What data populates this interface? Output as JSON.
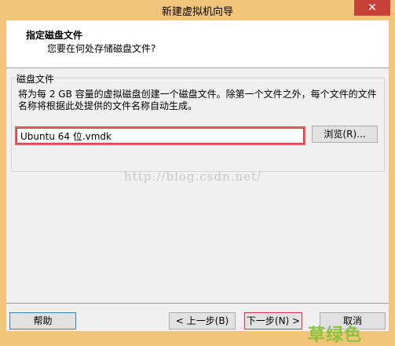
{
  "window": {
    "title": "新建虚拟机向导",
    "close_label": "✕"
  },
  "header": {
    "title": "指定磁盘文件",
    "subtitle": "您要在何处存储磁盘文件?"
  },
  "group": {
    "label": "磁盘文件",
    "description": "将为每 2 GB 容量的虚拟磁盘创建一个磁盘文件。除第一个文件之外，每个文件的文件名称将根据此处提供的文件名称自动生成。",
    "file_value": "Ubuntu 64 位.vmdk",
    "browse_label": "浏览(R)..."
  },
  "watermark": "http://blog.csdn.net/",
  "footer": {
    "help_label": "帮助",
    "back_label": "< 上一步(B)",
    "next_label": "下一步(N) >",
    "cancel_label": "取消"
  },
  "stamp": "草绿色",
  "colors": {
    "titlebar": "#f1c47a",
    "close": "#c7413a",
    "highlight": "#d33b3b",
    "stamp": "#8ac43f"
  }
}
